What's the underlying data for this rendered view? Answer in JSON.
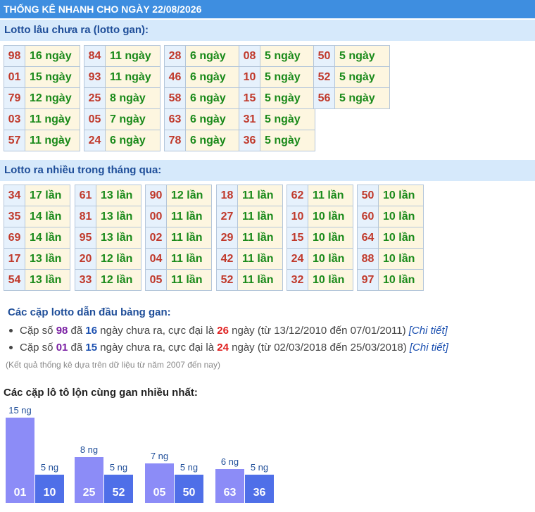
{
  "header": {
    "title": "THỐNG KÊ NHANH CHO NGÀY 22/08/2026"
  },
  "gan": {
    "title": "Lotto lâu chưa ra (lotto gan):",
    "columns": [
      [
        [
          "98",
          "16 ngày"
        ],
        [
          "01",
          "15 ngày"
        ],
        [
          "79",
          "12 ngày"
        ],
        [
          "03",
          "11 ngày"
        ],
        [
          "57",
          "11 ngày"
        ]
      ],
      [
        [
          "84",
          "11 ngày"
        ],
        [
          "93",
          "11 ngày"
        ],
        [
          "25",
          "8 ngày"
        ],
        [
          "05",
          "7 ngày"
        ],
        [
          "24",
          "6 ngày"
        ]
      ],
      [
        [
          "28",
          "6 ngày"
        ],
        [
          "46",
          "6 ngày"
        ],
        [
          "58",
          "6 ngày"
        ],
        [
          "63",
          "6 ngày"
        ],
        [
          "78",
          "6 ngày"
        ]
      ],
      [
        [
          "08",
          "5 ngày"
        ],
        [
          "10",
          "5 ngày"
        ],
        [
          "15",
          "5 ngày"
        ],
        [
          "31",
          "5 ngày"
        ],
        [
          "36",
          "5 ngày"
        ]
      ],
      [
        [
          "50",
          "5 ngày"
        ],
        [
          "52",
          "5 ngày"
        ],
        [
          "56",
          "5 ngày"
        ]
      ]
    ]
  },
  "nhieu": {
    "title": "Lotto ra nhiều trong tháng qua:",
    "columns": [
      [
        [
          "34",
          "17 lần"
        ],
        [
          "35",
          "14 lần"
        ],
        [
          "69",
          "14 lần"
        ],
        [
          "17",
          "13 lần"
        ],
        [
          "54",
          "13 lần"
        ]
      ],
      [
        [
          "61",
          "13 lần"
        ],
        [
          "81",
          "13 lần"
        ],
        [
          "95",
          "13 lần"
        ],
        [
          "20",
          "12 lần"
        ],
        [
          "33",
          "12 lần"
        ]
      ],
      [
        [
          "90",
          "12 lần"
        ],
        [
          "00",
          "11 lần"
        ],
        [
          "02",
          "11 lần"
        ],
        [
          "04",
          "11 lần"
        ],
        [
          "05",
          "11 lần"
        ]
      ],
      [
        [
          "18",
          "11 lần"
        ],
        [
          "27",
          "11 lần"
        ],
        [
          "29",
          "11 lần"
        ],
        [
          "42",
          "11 lần"
        ],
        [
          "52",
          "11 lần"
        ]
      ],
      [
        [
          "62",
          "11 lần"
        ],
        [
          "10",
          "10 lần"
        ],
        [
          "15",
          "10 lần"
        ],
        [
          "24",
          "10 lần"
        ],
        [
          "32",
          "10 lần"
        ]
      ],
      [
        [
          "50",
          "10 lần"
        ],
        [
          "60",
          "10 lần"
        ],
        [
          "64",
          "10 lần"
        ],
        [
          "88",
          "10 lần"
        ],
        [
          "97",
          "10 lần"
        ]
      ]
    ]
  },
  "pairs": {
    "title": "Các cặp lotto dẫn đầu bảng gan:",
    "items": [
      {
        "p1": "Cặp số ",
        "num": "98",
        "p2": " đã ",
        "days": "16",
        "p3": " ngày chưa ra, cực đại là ",
        "max": "26",
        "p4": " ngày (từ 13/12/2010 đến 07/01/2011) ",
        "link": "[Chi tiết]"
      },
      {
        "p1": "Cặp số ",
        "num": "01",
        "p2": " đã ",
        "days": "15",
        "p3": " ngày chưa ra, cực đại là ",
        "max": "24",
        "p4": " ngày (từ 02/03/2018 đến 25/03/2018) ",
        "link": "[Chi tiết]"
      }
    ],
    "note": "(Kết quả thống kê dựa trên dữ liệu từ năm 2007 đến nay)"
  },
  "chart_data": {
    "type": "bar",
    "title": "Các cặp lô tô lộn cùng gan nhiều nhất:",
    "groups": [
      [
        {
          "label": "01",
          "value": 15,
          "value_label": "15 ng"
        },
        {
          "label": "10",
          "value": 5,
          "value_label": "5 ng"
        }
      ],
      [
        {
          "label": "25",
          "value": 8,
          "value_label": "8 ng"
        },
        {
          "label": "52",
          "value": 5,
          "value_label": "5 ng"
        }
      ],
      [
        {
          "label": "05",
          "value": 7,
          "value_label": "7 ng"
        },
        {
          "label": "50",
          "value": 5,
          "value_label": "5 ng"
        }
      ],
      [
        {
          "label": "63",
          "value": 6,
          "value_label": "6 ng"
        },
        {
          "label": "36",
          "value": 5,
          "value_label": "5 ng"
        }
      ]
    ],
    "colors": {
      "primary": "#8c8cf7",
      "secondary": "#4f6fe8"
    }
  }
}
